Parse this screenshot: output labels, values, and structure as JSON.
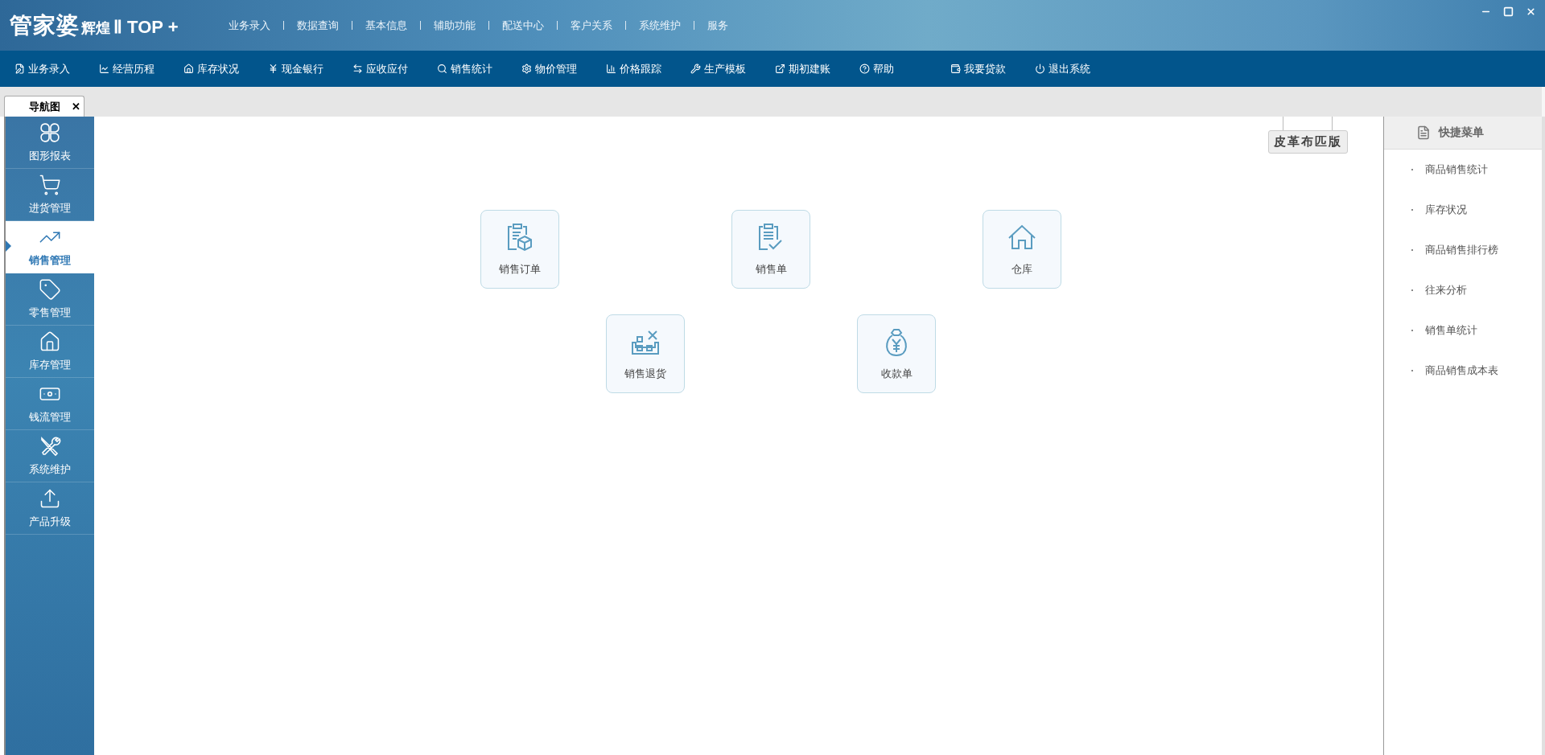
{
  "logo": {
    "brand": "管家婆",
    "edition": "辉煌",
    "version": "Ⅱ TOP +"
  },
  "top_menu": [
    "业务录入",
    "数据查询",
    "基本信息",
    "辅助功能",
    "配送中心",
    "客户关系",
    "系统维护",
    "服务"
  ],
  "toolbar": [
    {
      "label": "业务录入"
    },
    {
      "label": "经营历程"
    },
    {
      "label": "库存状况"
    },
    {
      "label": "现金银行"
    },
    {
      "label": "应收应付"
    },
    {
      "label": "销售统计"
    },
    {
      "label": "物价管理"
    },
    {
      "label": "价格跟踪"
    },
    {
      "label": "生产模板"
    },
    {
      "label": "期初建账"
    },
    {
      "label": "帮助"
    },
    {
      "label": "我要贷款"
    },
    {
      "label": "退出系统"
    }
  ],
  "tabs": [
    {
      "label": "导航图",
      "selected": true,
      "close": "✕"
    }
  ],
  "sidebar": [
    {
      "label": "图形报表",
      "selected": false
    },
    {
      "label": "进货管理",
      "selected": false
    },
    {
      "label": "销售管理",
      "selected": true
    },
    {
      "label": "零售管理",
      "selected": false
    },
    {
      "label": "库存管理",
      "selected": false
    },
    {
      "label": "钱流管理",
      "selected": false
    },
    {
      "label": "系统维护",
      "selected": false
    },
    {
      "label": "产品升级",
      "selected": false
    }
  ],
  "edition_sign": "皮革布匹版",
  "nav_cards": [
    {
      "label": "销售订单"
    },
    {
      "label": "销售单"
    },
    {
      "label": "仓库"
    },
    {
      "label": "销售退货"
    },
    {
      "label": "收款单"
    }
  ],
  "quick_menu": {
    "title": "快捷菜单",
    "items": [
      "商品销售统计",
      "库存状况",
      "商品销售排行榜",
      "往来分析",
      "销售单统计",
      "商品销售成本表"
    ]
  }
}
